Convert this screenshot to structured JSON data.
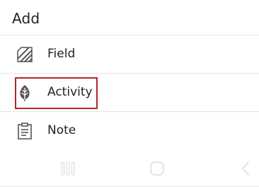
{
  "sheet": {
    "title": "Add",
    "items": [
      {
        "label": "Field",
        "icon": "field-hatch-icon"
      },
      {
        "label": "Activity",
        "icon": "leaf-icon"
      },
      {
        "label": "Note",
        "icon": "clipboard-note-icon"
      }
    ],
    "highlighted_item": "Activity",
    "highlight_color": "#b3262d"
  },
  "navbar": {
    "buttons": [
      {
        "icon": "recents-icon"
      },
      {
        "icon": "home-icon"
      },
      {
        "icon": "back-icon"
      }
    ]
  }
}
